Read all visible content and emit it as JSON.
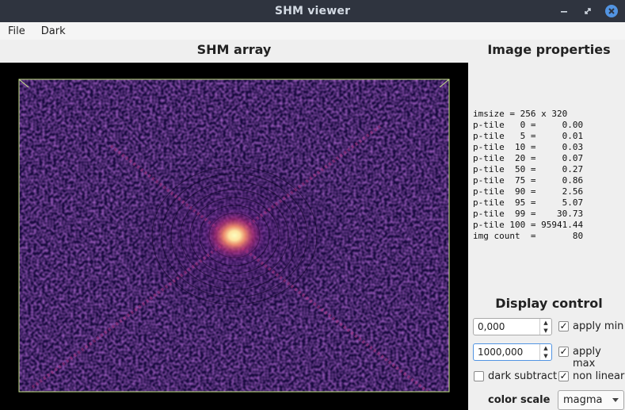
{
  "window": {
    "title": "SHM viewer"
  },
  "menu": {
    "file": "File",
    "dark": "Dark"
  },
  "left_panel": {
    "title": "SHM array"
  },
  "right_panel": {
    "title": "Image properties",
    "properties": [
      "imsize = 256 x 320",
      "p-tile   0 =     0.00",
      "p-tile   5 =     0.01",
      "p-tile  10 =     0.03",
      "p-tile  20 =     0.07",
      "p-tile  50 =     0.27",
      "p-tile  75 =     0.86",
      "p-tile  90 =     2.56",
      "p-tile  95 =     5.07",
      "p-tile  99 =    30.73",
      "p-tile 100 = 95941.44",
      "img count  =       80"
    ]
  },
  "display_control": {
    "title": "Display control",
    "min_value": "0,000",
    "max_value": "1000,000",
    "apply_min": {
      "label": "apply min",
      "checked": true
    },
    "apply_max": {
      "label": "apply max",
      "checked": true
    },
    "dark_subtract": {
      "label": "dark subtract",
      "checked": false
    },
    "non_linear": {
      "label": "non linear",
      "checked": true
    },
    "color_scale_label": "color scale",
    "color_scale_value": "magma"
  },
  "colors": {
    "titlebar": "#2f343f",
    "close": "#5294e2",
    "image_border": "#c8e68a",
    "magma_low": "#1b0c41",
    "magma_mid": "#a3307e",
    "magma_high": "#fcfdbf"
  }
}
